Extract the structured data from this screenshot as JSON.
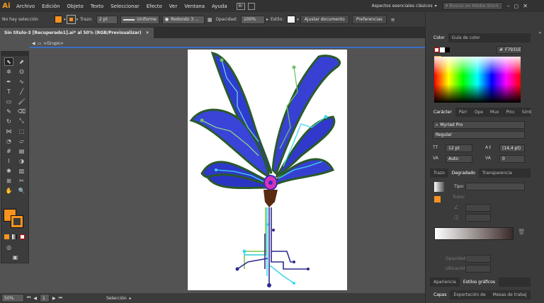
{
  "app": {
    "logo": "Ai"
  },
  "menu": [
    "Archivo",
    "Edición",
    "Objeto",
    "Texto",
    "Seleccionar",
    "Efecto",
    "Ver",
    "Ventana",
    "Ayuda"
  ],
  "workspace": "Aspectos esenciales clásicos",
  "search_placeholder": "Buscar en Adobe Stock",
  "control": {
    "selection": "No hay selección",
    "stroke_label": "Trazo:",
    "stroke_value": "2 pt",
    "profile": "Uniforme",
    "brush": "Redondo 3 ...",
    "opacity_label": "Opacidad:",
    "opacity_value": "100%",
    "style_label": "Estilo:",
    "doc_settings": "Ajustar documento",
    "preferences": "Preferencias",
    "fill_color": "#f7931e"
  },
  "document": {
    "tab_title": "Sin título-3 [Recuperado1].ai* al 50% (RGB/Previsualizar)",
    "breadcrumb": "<Grupo>"
  },
  "status": {
    "zoom": "50%",
    "page": "1",
    "mode": "Selección"
  },
  "color_panel": {
    "tabs": [
      "Color",
      "Guía de color"
    ],
    "hex": "F7931E"
  },
  "char_panel": {
    "tabs": [
      "Carácter",
      "Párr",
      "Ope",
      "Mux",
      "Pinc",
      "Simt"
    ],
    "search": "Myriad Pro",
    "font": "Myriad Pro",
    "style": "Regular",
    "size": "12 pt",
    "leading": "(14,4 pt)",
    "kerning": "Auto",
    "tracking": "0"
  },
  "gradient_panel": {
    "tabs": [
      "Trazo",
      "Degradado",
      "Transparencia"
    ],
    "type_label": "Tipo:",
    "stroke_label": "Trazo:",
    "opacity_label": "Opacidad:",
    "location_label": "Ubicación:"
  },
  "bottom_tabs": {
    "row1": [
      "Apariencia",
      "Estilos gráficos"
    ],
    "row2": [
      "Capas",
      "Exportación de",
      "Mesas de trabaj"
    ]
  }
}
